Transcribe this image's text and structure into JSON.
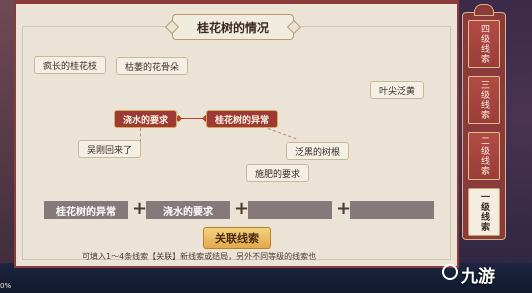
{
  "panel": {
    "title": "桂花树的情况"
  },
  "clues": [
    {
      "id": "c1",
      "label": "疯长的桂花枝",
      "active": false
    },
    {
      "id": "c2",
      "label": "枯萎的花骨朵",
      "active": false
    },
    {
      "id": "c3",
      "label": "叶尖泛黄",
      "active": false
    },
    {
      "id": "c4",
      "label": "浇水的要求",
      "active": true
    },
    {
      "id": "c5",
      "label": "桂花树的异常",
      "active": true
    },
    {
      "id": "c6",
      "label": "吴刚回来了",
      "active": false
    },
    {
      "id": "c7",
      "label": "泛黑的树根",
      "active": false
    },
    {
      "id": "c8",
      "label": "施肥的要求",
      "active": false
    }
  ],
  "slots": [
    "桂花树的异常",
    "浇水的要求",
    "",
    ""
  ],
  "plus_symbol": "+",
  "link_button": "关联线索",
  "hint": "可填入1～4条线索【关联】新线索或结局，另外不同等级的线索也",
  "tabs": [
    {
      "label": "四级线索",
      "selected": false
    },
    {
      "label": "三级线索",
      "selected": false
    },
    {
      "label": "二级线索",
      "selected": false
    },
    {
      "label": "一级线索",
      "selected": true
    }
  ],
  "watermark": {
    "text": "九游"
  },
  "corner_text": "0%"
}
